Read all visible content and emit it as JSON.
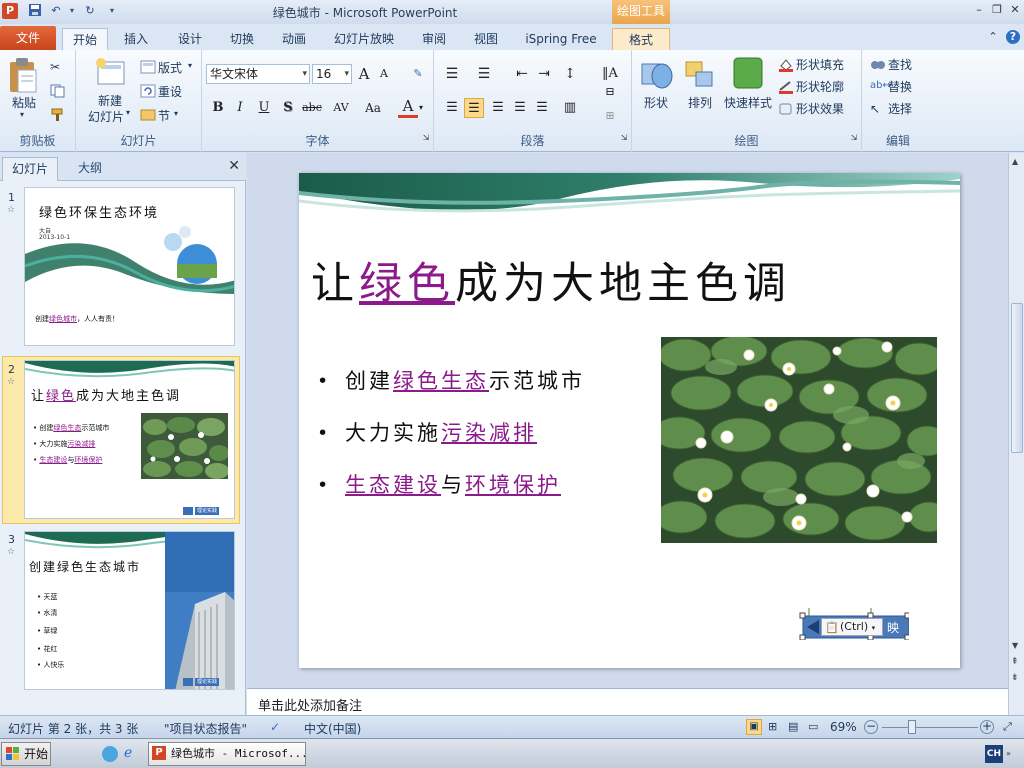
{
  "window": {
    "title": "绿色城市 - Microsoft PowerPoint",
    "context_tool": "绘图工具"
  },
  "ribbon_tabs": [
    {
      "label": "文件"
    },
    {
      "label": "开始"
    },
    {
      "label": "插入"
    },
    {
      "label": "设计"
    },
    {
      "label": "切换"
    },
    {
      "label": "动画"
    },
    {
      "label": "幻灯片放映"
    },
    {
      "label": "审阅"
    },
    {
      "label": "视图"
    },
    {
      "label": "iSpring Free"
    },
    {
      "label": "格式"
    }
  ],
  "ribbon": {
    "clipboard": {
      "paste": "粘贴",
      "label": "剪贴板"
    },
    "slides": {
      "new_slide_line1": "新建",
      "new_slide_line2": "幻灯片",
      "layout": "版式",
      "reset": "重设",
      "section": "节",
      "label": "幻灯片"
    },
    "font": {
      "font_name": "华文宋体",
      "font_size": "16",
      "label": "字体",
      "bold": "B",
      "italic": "I",
      "underline": "U",
      "shadow": "S",
      "strike": "abc",
      "spacing": "AV",
      "case": "Aa",
      "color": "A",
      "grow": "A",
      "shrink": "A"
    },
    "paragraph": {
      "label": "段落"
    },
    "drawing": {
      "shape": "形状",
      "arrange": "排列",
      "quick_styles": "快速样式",
      "shape_fill": "形状填充",
      "shape_outline": "形状轮廓",
      "shape_effects": "形状效果",
      "label": "绘图"
    },
    "editing": {
      "find": "查找",
      "replace": "替换",
      "select": "选择",
      "label": "编辑"
    }
  },
  "left_panel": {
    "tab_slides": "幻灯片",
    "tab_outline": "大纲",
    "close": "✕",
    "slides": [
      {
        "num": "1",
        "title": "绿色环保生态环境",
        "sub1": "大自",
        "sub2": "2013-10-1",
        "footer_a": "创建",
        "footer_hl": "绿色城市",
        "footer_b": "，人人有责！"
      },
      {
        "num": "2",
        "title_a": "让",
        "title_hl": "绿色",
        "title_b": "成为大地主色调",
        "b1_a": "创建",
        "b1_hl": "绿色生态",
        "b1_b": "示范城市",
        "b2_a": "大力实施",
        "b2_hl": "污染减排",
        "b3_hl1": "生态建设",
        "b3_a": "与",
        "b3_hl2": "环境保护",
        "btn": "理论实践"
      },
      {
        "num": "3",
        "title": "创建绿色生态城市",
        "items": [
          "天蓝",
          "水清",
          "草绿",
          "花红",
          "人快乐"
        ],
        "btn": "理论实践"
      }
    ]
  },
  "slide": {
    "title_a": "让",
    "title_hl": "绿色",
    "title_b": "成为大地主色调",
    "bullet1_a": "创建",
    "bullet1_hl": "绿色生态",
    "bullet1_b": "示范城市",
    "bullet2_a": "大力实施",
    "bullet2_hl": "污染减排",
    "bullet3_hl1": "生态建设",
    "bullet3_a": "与",
    "bullet3_hl2": "环境保护",
    "paste_options": "(Ctrl)",
    "partial_text": "映"
  },
  "notes": {
    "placeholder": "单击此处添加备注"
  },
  "statusbar": {
    "slide_info": "幻灯片 第 2 张，共 3 张",
    "theme": "\"项目状态报告\"",
    "language": "中文(中国)",
    "zoom": "69%"
  },
  "taskbar": {
    "start": "开始",
    "window_button": "绿色城市 - Microsof...",
    "ime": "CH"
  },
  "colors": {
    "hyperlink": "#8b1a8b",
    "file_tab": "#d24726",
    "context_tab": "#eaa54a",
    "selection": "#fde9a9"
  }
}
